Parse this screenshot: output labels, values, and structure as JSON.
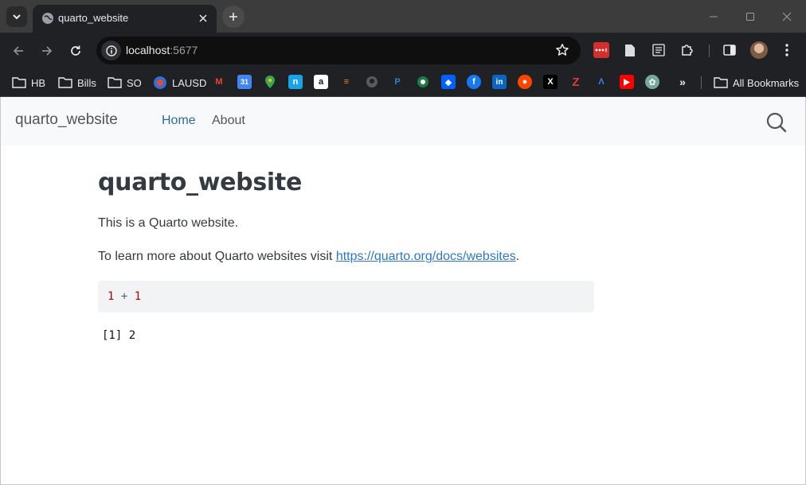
{
  "browser": {
    "tab": {
      "title": "quarto_website"
    },
    "url": {
      "host": "localhost",
      "port": ":5677"
    },
    "bookmarks": {
      "folders": [
        {
          "label": "HB"
        },
        {
          "label": "Bills"
        },
        {
          "label": "SO"
        }
      ],
      "lausd_label": "LAUSD",
      "all_bookmarks_label": "All Bookmarks"
    }
  },
  "site": {
    "brand": "quarto_website",
    "nav": [
      {
        "label": "Home"
      },
      {
        "label": "About"
      }
    ]
  },
  "main": {
    "title": "quarto_website",
    "intro": "This is a Quarto website.",
    "learn_more_prefix": "To learn more about Quarto websites visit ",
    "learn_more_link": "https://quarto.org/docs/websites",
    "learn_more_suffix": ".",
    "code": {
      "left": "1",
      "op": "+",
      "right": "1"
    },
    "output": "[1] 2"
  },
  "colors": {
    "link": "#2c78c8",
    "nav_active": "#2c6b9e",
    "code_number": "#ad0000",
    "navbar_bg": "#f8f9fa"
  }
}
